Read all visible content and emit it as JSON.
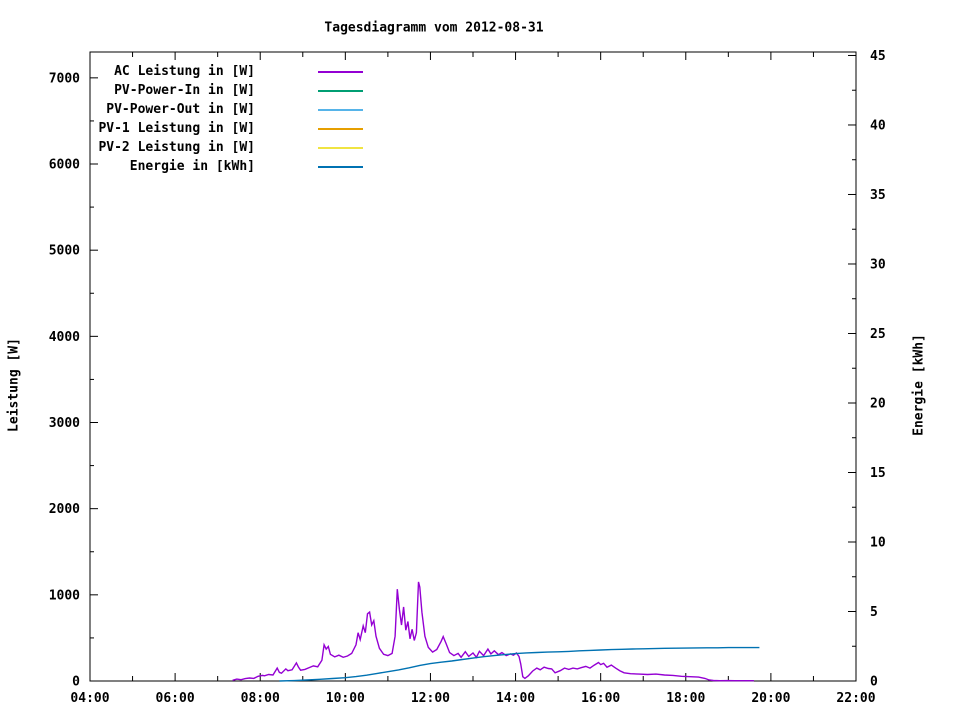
{
  "title": "Tagesdiagramm vom 2012-08-31",
  "legend": {
    "position": "top-left-inside",
    "items": [
      {
        "label": "AC Leistung in [W]",
        "color": "#9400d3"
      },
      {
        "label": "PV-Power-In in [W]",
        "color": "#009e73"
      },
      {
        "label": "PV-Power-Out in [W]",
        "color": "#56b4e9"
      },
      {
        "label": "PV-1 Leistung in [W]",
        "color": "#e69f00"
      },
      {
        "label": "PV-2 Leistung in [W]",
        "color": "#f0e442"
      },
      {
        "label": "Energie in [kWh]",
        "color": "#0072b2"
      }
    ]
  },
  "chart_data": {
    "type": "line",
    "title": "Tagesdiagramm vom 2012-08-31",
    "grid": false,
    "legend_position": "top-left-inside",
    "x_axis": {
      "unit": "time of day",
      "range_hours": [
        4,
        22
      ],
      "major_step_hours": 2,
      "minor_step_hours": 1,
      "tick_labels": [
        "04:00",
        "06:00",
        "08:00",
        "10:00",
        "12:00",
        "14:00",
        "16:00",
        "18:00",
        "20:00",
        "22:00"
      ]
    },
    "y_left": {
      "label": "Leistung [W]",
      "plot_max": 7300,
      "major_step": 1000,
      "minor_step": 500,
      "tick_max": 7000,
      "tick_labels": [
        "0",
        "1000",
        "2000",
        "3000",
        "4000",
        "5000",
        "6000",
        "7000"
      ]
    },
    "y_right": {
      "label": "Energie [kWh]",
      "plot_max": 45.25,
      "major_step": 5,
      "minor_step": 2.5,
      "tick_max": 45,
      "tick_labels": [
        "0",
        "5",
        "10",
        "15",
        "20",
        "25",
        "30",
        "35",
        "40",
        "45"
      ]
    },
    "series": [
      {
        "name": "AC Leistung in [W]",
        "color": "#9400d3",
        "axis": "left",
        "points": [
          [
            7.35,
            8
          ],
          [
            7.45,
            22
          ],
          [
            7.55,
            15
          ],
          [
            7.65,
            28
          ],
          [
            7.75,
            35
          ],
          [
            7.85,
            30
          ],
          [
            7.95,
            55
          ],
          [
            8.05,
            65
          ],
          [
            8.1,
            60
          ],
          [
            8.2,
            75
          ],
          [
            8.3,
            70
          ],
          [
            8.4,
            150
          ],
          [
            8.45,
            100
          ],
          [
            8.5,
            90
          ],
          [
            8.6,
            140
          ],
          [
            8.65,
            120
          ],
          [
            8.75,
            130
          ],
          [
            8.85,
            210
          ],
          [
            8.9,
            160
          ],
          [
            8.95,
            125
          ],
          [
            9.05,
            135
          ],
          [
            9.15,
            155
          ],
          [
            9.25,
            175
          ],
          [
            9.35,
            165
          ],
          [
            9.45,
            240
          ],
          [
            9.5,
            420
          ],
          [
            9.55,
            370
          ],
          [
            9.6,
            400
          ],
          [
            9.65,
            310
          ],
          [
            9.75,
            280
          ],
          [
            9.85,
            300
          ],
          [
            9.95,
            275
          ],
          [
            10.05,
            290
          ],
          [
            10.15,
            320
          ],
          [
            10.25,
            420
          ],
          [
            10.3,
            560
          ],
          [
            10.35,
            480
          ],
          [
            10.42,
            640
          ],
          [
            10.47,
            560
          ],
          [
            10.52,
            780
          ],
          [
            10.57,
            800
          ],
          [
            10.62,
            650
          ],
          [
            10.67,
            700
          ],
          [
            10.72,
            520
          ],
          [
            10.8,
            380
          ],
          [
            10.9,
            310
          ],
          [
            11.0,
            295
          ],
          [
            11.1,
            320
          ],
          [
            11.17,
            520
          ],
          [
            11.22,
            1065
          ],
          [
            11.27,
            830
          ],
          [
            11.32,
            650
          ],
          [
            11.37,
            860
          ],
          [
            11.42,
            590
          ],
          [
            11.47,
            690
          ],
          [
            11.52,
            490
          ],
          [
            11.57,
            600
          ],
          [
            11.62,
            470
          ],
          [
            11.67,
            560
          ],
          [
            11.72,
            1150
          ],
          [
            11.75,
            1090
          ],
          [
            11.8,
            800
          ],
          [
            11.87,
            520
          ],
          [
            11.95,
            390
          ],
          [
            12.05,
            335
          ],
          [
            12.15,
            365
          ],
          [
            12.25,
            460
          ],
          [
            12.3,
            515
          ],
          [
            12.37,
            430
          ],
          [
            12.45,
            330
          ],
          [
            12.55,
            295
          ],
          [
            12.65,
            320
          ],
          [
            12.72,
            275
          ],
          [
            12.82,
            340
          ],
          [
            12.9,
            285
          ],
          [
            13.0,
            325
          ],
          [
            13.08,
            275
          ],
          [
            13.15,
            345
          ],
          [
            13.25,
            295
          ],
          [
            13.35,
            370
          ],
          [
            13.42,
            315
          ],
          [
            13.5,
            350
          ],
          [
            13.6,
            305
          ],
          [
            13.68,
            330
          ],
          [
            13.78,
            295
          ],
          [
            13.88,
            315
          ],
          [
            13.95,
            300
          ],
          [
            14.02,
            325
          ],
          [
            14.08,
            285
          ],
          [
            14.12,
            200
          ],
          [
            14.17,
            50
          ],
          [
            14.22,
            30
          ],
          [
            14.3,
            60
          ],
          [
            14.4,
            115
          ],
          [
            14.5,
            150
          ],
          [
            14.58,
            130
          ],
          [
            14.67,
            160
          ],
          [
            14.77,
            145
          ],
          [
            14.85,
            140
          ],
          [
            14.93,
            95
          ],
          [
            15.05,
            120
          ],
          [
            15.15,
            150
          ],
          [
            15.25,
            135
          ],
          [
            15.35,
            150
          ],
          [
            15.45,
            140
          ],
          [
            15.55,
            155
          ],
          [
            15.65,
            170
          ],
          [
            15.75,
            150
          ],
          [
            15.85,
            185
          ],
          [
            15.95,
            215
          ],
          [
            16.0,
            190
          ],
          [
            16.07,
            205
          ],
          [
            16.15,
            160
          ],
          [
            16.25,
            185
          ],
          [
            16.35,
            150
          ],
          [
            16.45,
            120
          ],
          [
            16.55,
            95
          ],
          [
            16.7,
            85
          ],
          [
            16.9,
            80
          ],
          [
            17.1,
            75
          ],
          [
            17.3,
            80
          ],
          [
            17.5,
            70
          ],
          [
            17.7,
            65
          ],
          [
            17.9,
            55
          ],
          [
            18.1,
            50
          ],
          [
            18.3,
            45
          ],
          [
            18.45,
            30
          ],
          [
            18.55,
            12
          ],
          [
            18.65,
            6
          ],
          [
            18.8,
            4
          ],
          [
            19.0,
            5
          ],
          [
            19.15,
            3
          ],
          [
            19.3,
            4
          ],
          [
            19.45,
            3
          ],
          [
            19.6,
            4
          ]
        ]
      },
      {
        "name": "PV-Power-In in [W]",
        "color": "#009e73",
        "axis": "left",
        "points": []
      },
      {
        "name": "PV-Power-Out in [W]",
        "color": "#56b4e9",
        "axis": "left",
        "points": []
      },
      {
        "name": "PV-1 Leistung in [W]",
        "color": "#e69f00",
        "axis": "left",
        "points": []
      },
      {
        "name": "PV-2 Leistung in [W]",
        "color": "#f0e442",
        "axis": "left",
        "points": []
      },
      {
        "name": "Energie in [kWh]",
        "color": "#0072b2",
        "axis": "right",
        "points": [
          [
            8.45,
            0.0
          ],
          [
            8.8,
            0.03
          ],
          [
            9.1,
            0.07
          ],
          [
            9.4,
            0.12
          ],
          [
            9.7,
            0.18
          ],
          [
            10.0,
            0.24
          ],
          [
            10.25,
            0.32
          ],
          [
            10.5,
            0.42
          ],
          [
            10.75,
            0.55
          ],
          [
            11.0,
            0.67
          ],
          [
            11.25,
            0.8
          ],
          [
            11.5,
            0.95
          ],
          [
            11.75,
            1.12
          ],
          [
            12.0,
            1.25
          ],
          [
            12.25,
            1.35
          ],
          [
            12.5,
            1.44
          ],
          [
            12.75,
            1.55
          ],
          [
            13.0,
            1.65
          ],
          [
            13.25,
            1.75
          ],
          [
            13.5,
            1.83
          ],
          [
            13.75,
            1.9
          ],
          [
            14.0,
            1.97
          ],
          [
            14.25,
            2.02
          ],
          [
            14.5,
            2.05
          ],
          [
            14.75,
            2.08
          ],
          [
            15.0,
            2.1
          ],
          [
            15.25,
            2.13
          ],
          [
            15.5,
            2.17
          ],
          [
            15.75,
            2.2
          ],
          [
            16.0,
            2.23
          ],
          [
            16.25,
            2.26
          ],
          [
            16.5,
            2.28
          ],
          [
            16.75,
            2.3
          ],
          [
            17.0,
            2.32
          ],
          [
            17.25,
            2.33
          ],
          [
            17.5,
            2.35
          ],
          [
            17.75,
            2.36
          ],
          [
            18.0,
            2.37
          ],
          [
            18.25,
            2.38
          ],
          [
            18.5,
            2.39
          ],
          [
            18.75,
            2.39
          ],
          [
            19.0,
            2.4
          ],
          [
            19.3,
            2.4
          ],
          [
            19.73,
            2.4
          ]
        ]
      }
    ]
  }
}
